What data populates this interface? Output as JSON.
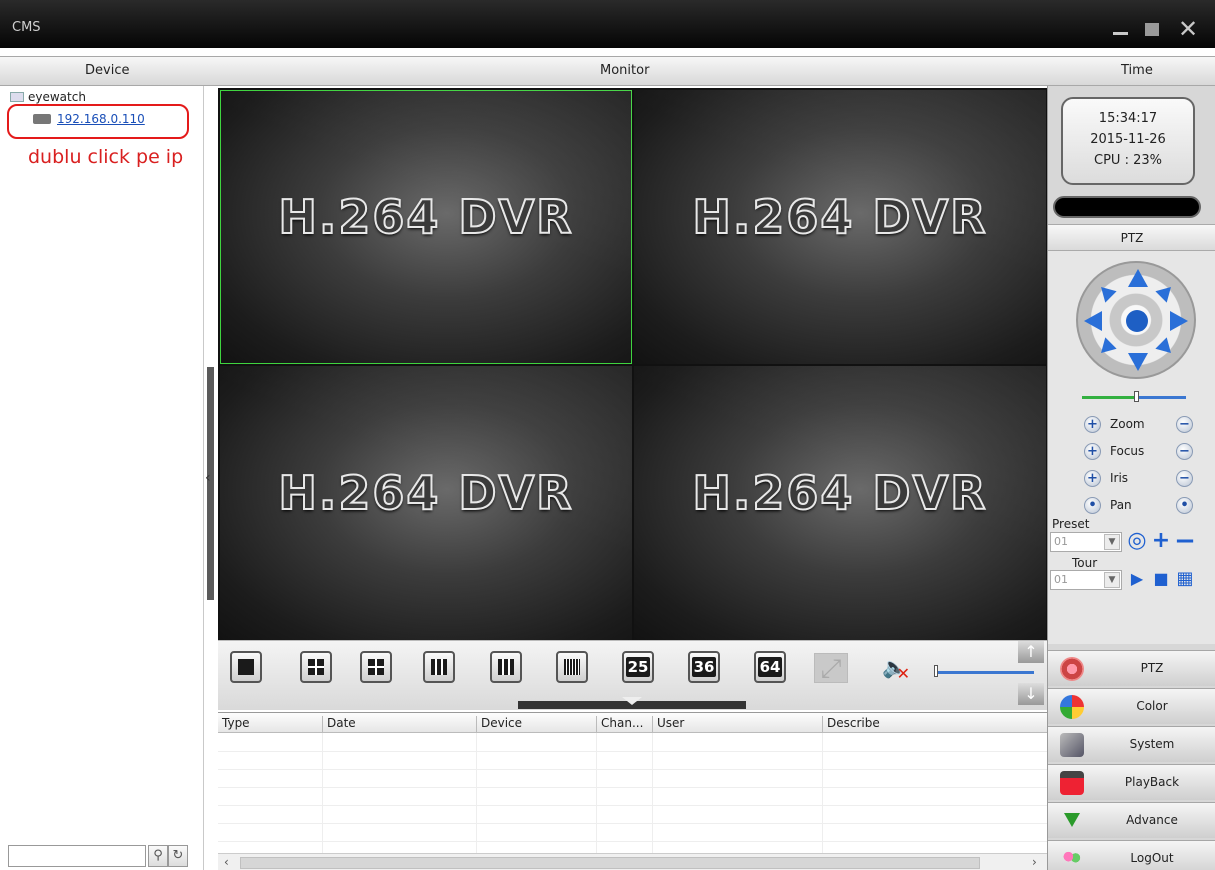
{
  "window": {
    "title": "CMS"
  },
  "header": {
    "device": "Device",
    "monitor": "Monitor",
    "time": "Time"
  },
  "device_tree": {
    "root": "eyewatch",
    "device_ip": "192.168.0.110",
    "annotation": "dublu click pe ip"
  },
  "video_cells": [
    {
      "label": "H.264 DVR",
      "selected": true
    },
    {
      "label": "H.264 DVR",
      "selected": false
    },
    {
      "label": "H.264 DVR",
      "selected": false
    },
    {
      "label": "H.264 DVR",
      "selected": false
    }
  ],
  "toolbar": {
    "layout_buttons": [
      "1",
      "4",
      "6",
      "8",
      "9",
      "16",
      "25",
      "36",
      "64"
    ],
    "num_25": "25",
    "num_36": "36",
    "num_64": "64"
  },
  "log_table": {
    "columns": [
      "Type",
      "Date",
      "Device",
      "Chan...",
      "User",
      "Describe"
    ]
  },
  "status": {
    "time": "15:34:17",
    "date": "2015-11-26",
    "cpu": "CPU : 23%"
  },
  "ptz": {
    "title": "PTZ",
    "controls": [
      "Zoom",
      "Focus",
      "Iris",
      "Pan"
    ],
    "preset_label": "Preset",
    "preset_value": "01",
    "tour_label": "Tour",
    "tour_value": "01"
  },
  "menu": [
    "PTZ",
    "Color",
    "System",
    "PlayBack",
    "Advance",
    "LogOut"
  ],
  "colors": {
    "selected_cell_border": "#3fd43f",
    "annotation": "#e41a1a",
    "accent": "#2a6fd8"
  }
}
